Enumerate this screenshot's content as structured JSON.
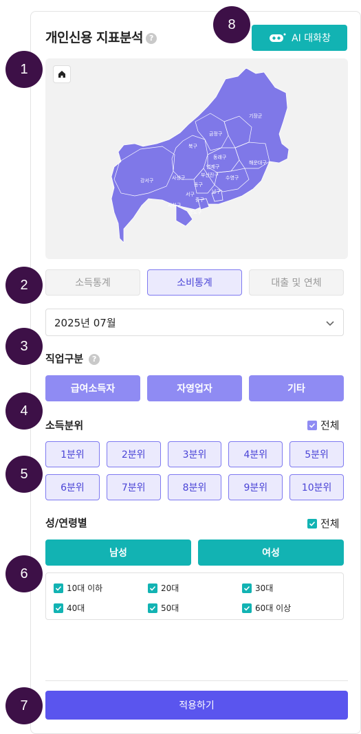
{
  "header": {
    "title": "개인신용 지표분석",
    "help_icon": "question-circle-icon"
  },
  "ai_button": {
    "label": "AI 대화창",
    "icon": "robot-icon"
  },
  "badges": [
    "1",
    "2",
    "3",
    "4",
    "5",
    "6",
    "7",
    "8"
  ],
  "map": {
    "home_icon": "home-icon",
    "districts": [
      "기장군",
      "금정구",
      "북구",
      "동래구",
      "연제구",
      "해운대구",
      "강서구",
      "사상구",
      "부산진구",
      "수영구",
      "남구",
      "사하구",
      "동구",
      "서구",
      "중구",
      "영도구"
    ]
  },
  "stat_tabs": {
    "items": [
      "소득통계",
      "소비통계",
      "대출 및 연체"
    ],
    "active": "소비통계"
  },
  "date_select": {
    "value": "2025년 07월"
  },
  "job": {
    "label": "직업구분",
    "options": [
      "급여소득자",
      "자영업자",
      "기타"
    ]
  },
  "income": {
    "label": "소득분위",
    "all_label": "전체",
    "all_checked": true,
    "row1": [
      "1분위",
      "2분위",
      "3분위",
      "4분위",
      "5분위"
    ],
    "row2": [
      "6분위",
      "7분위",
      "8분위",
      "9분위",
      "10분위"
    ]
  },
  "gender_age": {
    "label": "성/연령별",
    "all_label": "전체",
    "all_checked": true,
    "genders": [
      "남성",
      "여성"
    ],
    "ages": [
      "10대 이하",
      "20대",
      "30대",
      "40대",
      "50대",
      "60대 이상"
    ]
  },
  "apply_button": {
    "label": "적용하기"
  },
  "colors": {
    "primary": "#5a55ee",
    "secondary_purple": "#8f8bf3",
    "teal": "#12b3b3",
    "badge": "#3d1047",
    "map_fill": "#7f78e8"
  }
}
